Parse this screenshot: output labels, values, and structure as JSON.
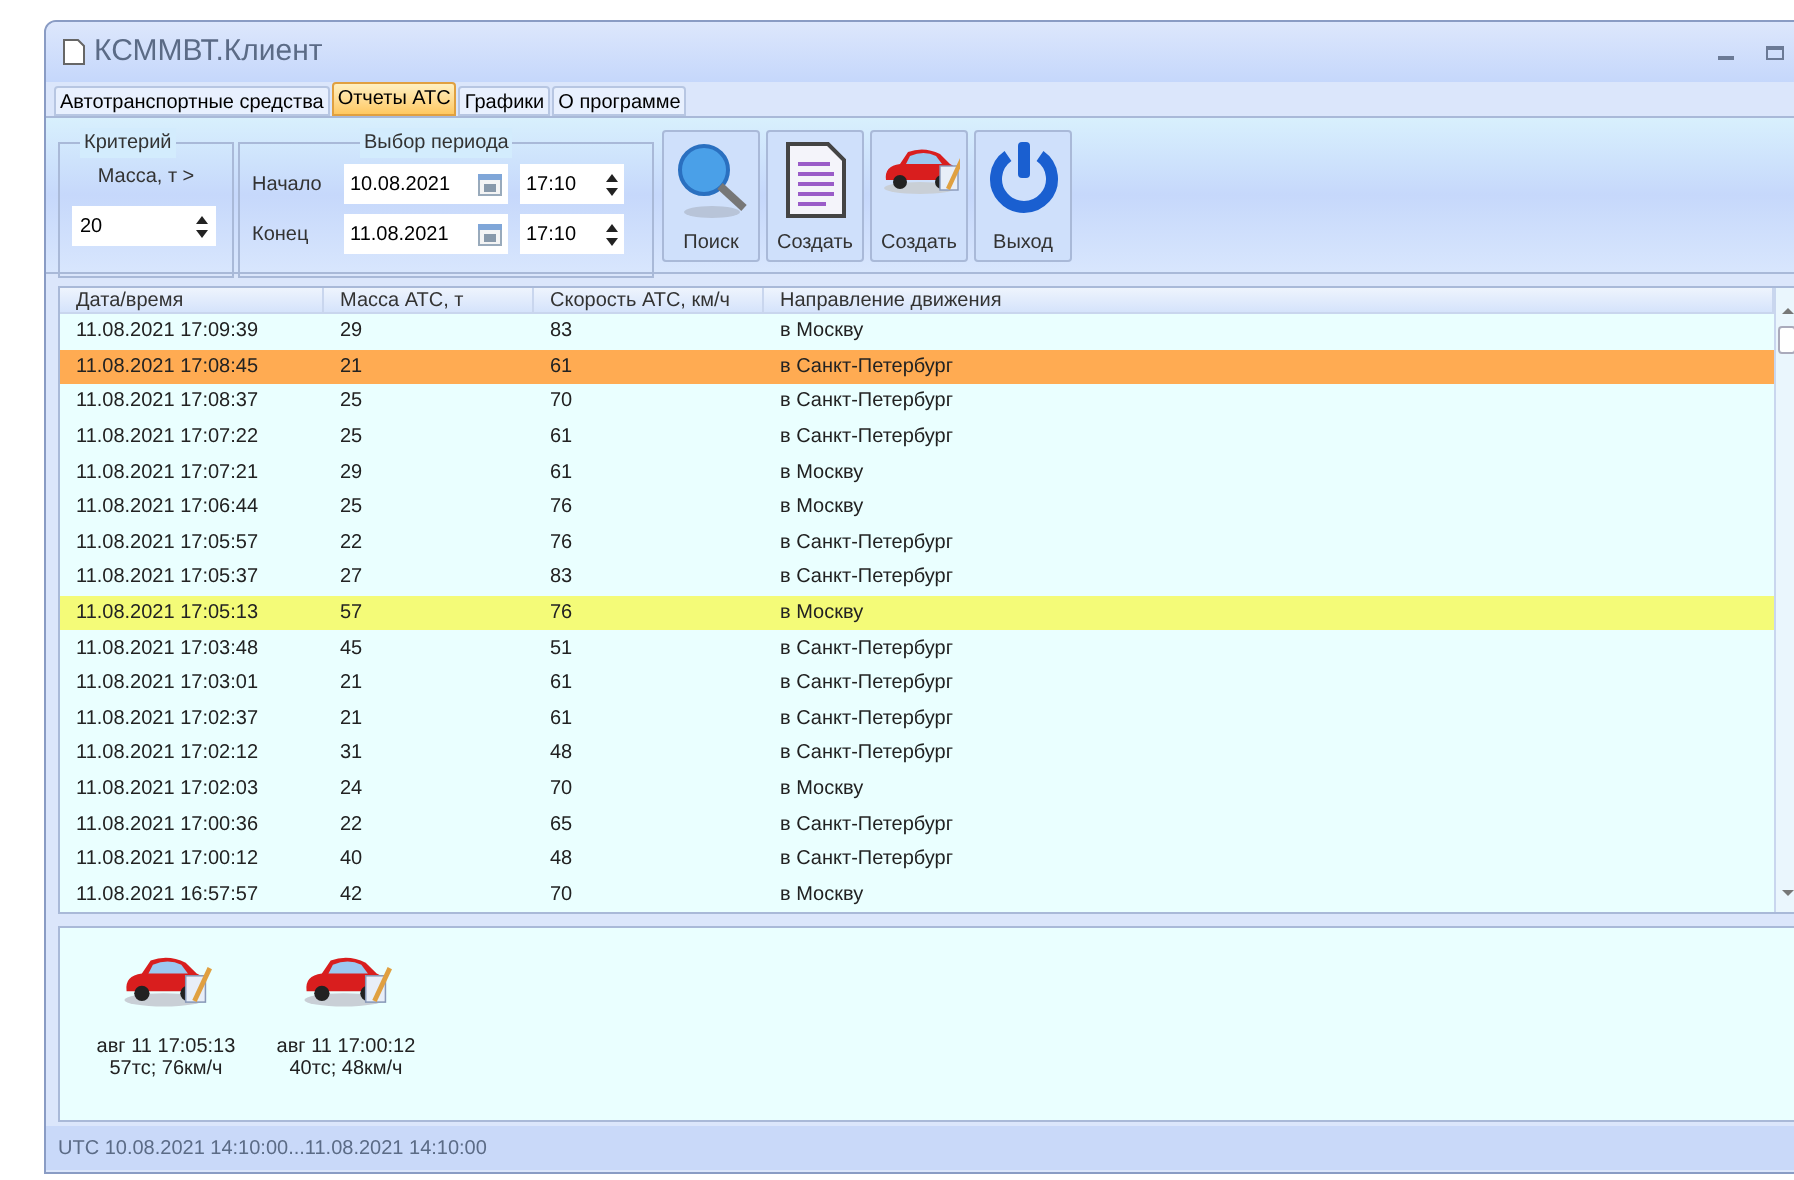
{
  "window": {
    "title": "КСММВТ.Клиент"
  },
  "tabs": [
    {
      "label": "Автотранспортные средства",
      "selected": false
    },
    {
      "label": "Отчеты АТС",
      "selected": true
    },
    {
      "label": "Графики",
      "selected": false
    },
    {
      "label": "О программе",
      "selected": false
    }
  ],
  "criteria": {
    "title": "Критерий",
    "label": "Масса, т >",
    "value": "20"
  },
  "period": {
    "title": "Выбор периода",
    "start_label": "Начало",
    "start_date": "10.08.2021",
    "start_time": "17:10",
    "end_label": "Конец",
    "end_date": "11.08.2021",
    "end_time": "17:10"
  },
  "toolbar": [
    {
      "kind": "search",
      "label": "Поиск"
    },
    {
      "kind": "report",
      "label": "Создать"
    },
    {
      "kind": "car",
      "label": "Создать"
    },
    {
      "kind": "exit",
      "label": "Выход"
    }
  ],
  "table": {
    "columns": [
      "Дата/время",
      "Масса АТС, т",
      "Скорость АТС, км/ч",
      "Направление движения"
    ],
    "rows": [
      {
        "cells": [
          "11.08.2021 17:09:39",
          "29",
          "83",
          "в Москву"
        ]
      },
      {
        "cells": [
          "11.08.2021 17:08:45",
          "21",
          "61",
          "в Санкт-Петербург"
        ],
        "color": "#ffab52"
      },
      {
        "cells": [
          "11.08.2021 17:08:37",
          "25",
          "70",
          "в Санкт-Петербург"
        ]
      },
      {
        "cells": [
          "11.08.2021 17:07:22",
          "25",
          "61",
          "в Санкт-Петербург"
        ]
      },
      {
        "cells": [
          "11.08.2021 17:07:21",
          "29",
          "61",
          "в Москву"
        ]
      },
      {
        "cells": [
          "11.08.2021 17:06:44",
          "25",
          "76",
          "в Москву"
        ]
      },
      {
        "cells": [
          "11.08.2021 17:05:57",
          "22",
          "76",
          "в Санкт-Петербург"
        ]
      },
      {
        "cells": [
          "11.08.2021 17:05:37",
          "27",
          "83",
          "в Санкт-Петербург"
        ]
      },
      {
        "cells": [
          "11.08.2021 17:05:13",
          "57",
          "76",
          "в Москву"
        ],
        "color": "#f4fb78"
      },
      {
        "cells": [
          "11.08.2021 17:03:48",
          "45",
          "51",
          "в Санкт-Петербург"
        ]
      },
      {
        "cells": [
          "11.08.2021 17:03:01",
          "21",
          "61",
          "в Санкт-Петербург"
        ]
      },
      {
        "cells": [
          "11.08.2021 17:02:37",
          "21",
          "61",
          "в Санкт-Петербург"
        ]
      },
      {
        "cells": [
          "11.08.2021 17:02:12",
          "31",
          "48",
          "в Санкт-Петербург"
        ]
      },
      {
        "cells": [
          "11.08.2021 17:02:03",
          "24",
          "70",
          "в Москву"
        ]
      },
      {
        "cells": [
          "11.08.2021 17:00:36",
          "22",
          "65",
          "в Санкт-Петербург"
        ]
      },
      {
        "cells": [
          "11.08.2021 17:00:12",
          "40",
          "48",
          "в Санкт-Петербург"
        ]
      },
      {
        "cells": [
          "11.08.2021 16:57:57",
          "42",
          "70",
          "в Москву"
        ]
      }
    ]
  },
  "vehicles": [
    {
      "line_1": "авг 11 17:05:13",
      "line_2": "57тс; 76км/ч"
    },
    {
      "line_1": "авг 11 17:00:12",
      "line_2": "40тс; 48км/ч"
    }
  ],
  "status_bar": "UTC 10.08.2021 14:10:00...11.08.2021 14:10:00"
}
